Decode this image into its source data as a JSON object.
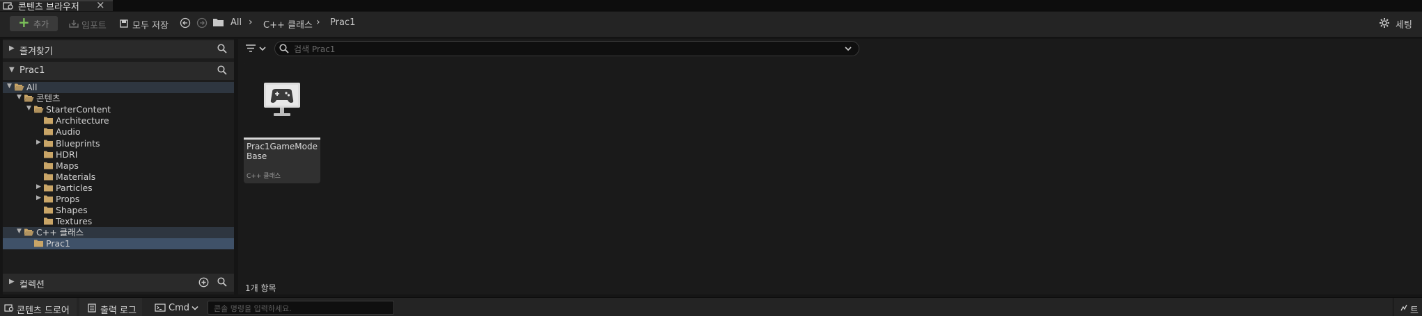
{
  "tab": {
    "title": "콘텐츠 브라우저",
    "close": "×"
  },
  "toolbar": {
    "add_label": "추가",
    "import_label": "임포트",
    "save_all_label": "모두 저장",
    "breadcrumbs": [
      "All",
      "C++ 클래스",
      "Prac1"
    ],
    "settings_label": "세팅"
  },
  "sidebar": {
    "favorites_title": "즐겨찾기",
    "project_title": "Prac1",
    "tree": [
      {
        "label": "All",
        "depth": 0,
        "expanded": true,
        "has_children": true,
        "state": "highlight"
      },
      {
        "label": "콘텐츠",
        "depth": 1,
        "expanded": true,
        "has_children": true
      },
      {
        "label": "StarterContent",
        "depth": 2,
        "expanded": true,
        "has_children": true
      },
      {
        "label": "Architecture",
        "depth": 3,
        "has_children": false
      },
      {
        "label": "Audio",
        "depth": 3,
        "has_children": false
      },
      {
        "label": "Blueprints",
        "depth": 3,
        "has_children": true
      },
      {
        "label": "HDRI",
        "depth": 3,
        "has_children": false
      },
      {
        "label": "Maps",
        "depth": 3,
        "has_children": false
      },
      {
        "label": "Materials",
        "depth": 3,
        "has_children": false
      },
      {
        "label": "Particles",
        "depth": 3,
        "has_children": true
      },
      {
        "label": "Props",
        "depth": 3,
        "has_children": true
      },
      {
        "label": "Shapes",
        "depth": 3,
        "has_children": false
      },
      {
        "label": "Textures",
        "depth": 3,
        "has_children": false
      },
      {
        "label": "C++ 클래스",
        "depth": 1,
        "expanded": true,
        "has_children": true,
        "state": "highlight"
      },
      {
        "label": "Prac1",
        "depth": 2,
        "has_children": false,
        "state": "selected"
      }
    ],
    "collections_title": "컬렉션"
  },
  "search": {
    "placeholder": "검색 Prac1"
  },
  "assets": [
    {
      "name": "Prac1GameModeBase",
      "type": "C++ 클래스"
    }
  ],
  "status": {
    "item_count": "1개 항목"
  },
  "bottom": {
    "content_drawer": "콘텐츠 드로어",
    "output_log": "출력 로그",
    "cmd_label": "Cmd",
    "console_placeholder": "콘솔 명령을 입력하세요.",
    "trace_label": "트"
  },
  "colors": {
    "folder": "#c9a567",
    "highlight_row": "#2e3640",
    "selected_row": "#3f5168",
    "add_plus": "#7cc25a"
  }
}
